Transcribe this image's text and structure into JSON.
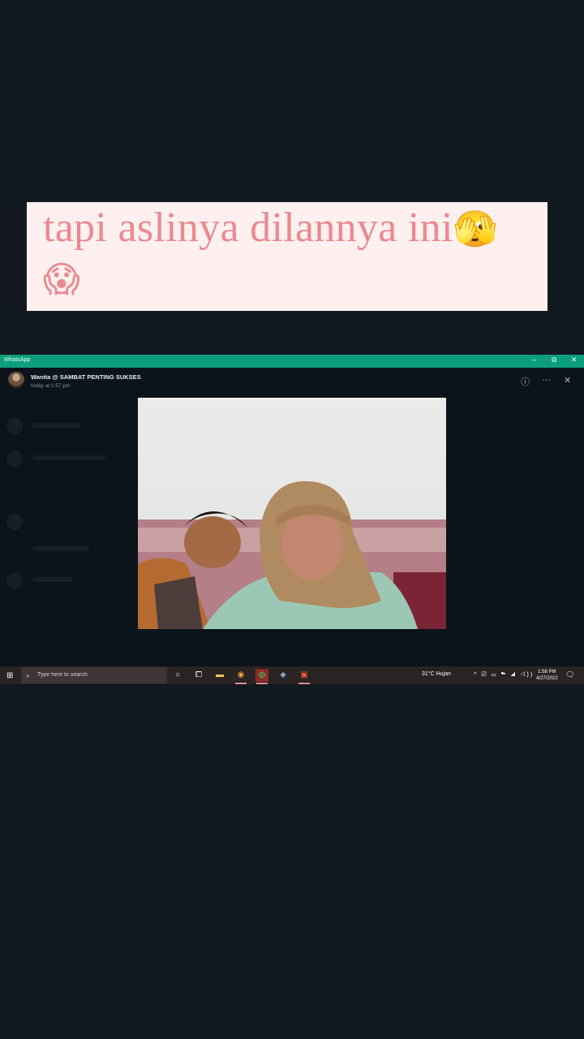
{
  "caption": {
    "text": "tapi aslinya dilannya ini",
    "emoji_1": "🫣",
    "emoji_2": "😱"
  },
  "whatsapp": {
    "app_title": "WhatsApp",
    "window_controls": {
      "minimize": "–",
      "restore": "⧉",
      "close": "✕"
    },
    "sender": "Wanita @ SAMBAT PENTING SUKSES",
    "timestamp": "today at 1:57 pm",
    "header_icons": [
      "info-icon",
      "more-icon",
      "close-icon"
    ],
    "header_glyphs": {
      "info": "ⓘ",
      "more": "···",
      "close": "✕"
    }
  },
  "taskbar": {
    "start_glyph": "⊞",
    "search_placeholder": "Type here to search",
    "search_glyph": "⌕",
    "task_view_glyph": "○",
    "weather": "31°C  Hujan",
    "tray": "^ ⎚ ▭ ☁ ◢ ◁))",
    "time": "1:58 PM",
    "date": "4/27/2022",
    "notification_glyph": "🗨",
    "apps": [
      {
        "name": "task-switcher-icon",
        "glyph": "⧠"
      },
      {
        "name": "file-explorer-icon",
        "glyph": "▬"
      },
      {
        "name": "chrome-icon",
        "glyph": "◉"
      },
      {
        "name": "whatsapp-icon",
        "glyph": "◍"
      },
      {
        "name": "photos-icon",
        "glyph": "◈"
      },
      {
        "name": "pdf-app-icon",
        "glyph": "▣"
      }
    ]
  },
  "colors": {
    "background": "#121920",
    "caption_bg": "#fff0f0",
    "caption_text": "#e98a8f",
    "wa_titlebar": "#0c9f7e",
    "taskbar": "#2a2324"
  }
}
